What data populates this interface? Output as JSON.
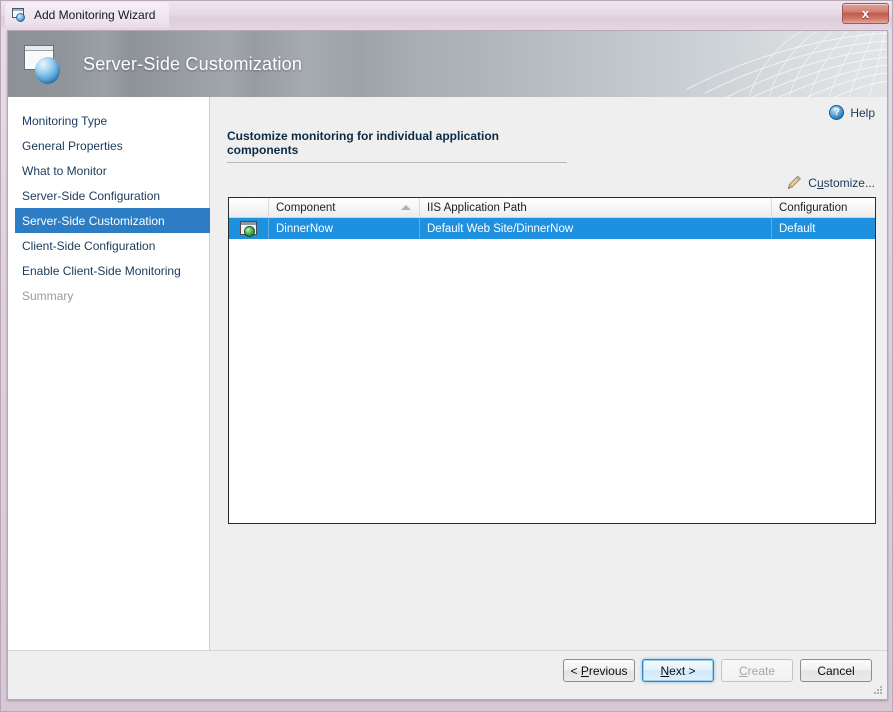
{
  "window": {
    "title": "Add Monitoring Wizard",
    "close_label": "x",
    "titlebar_icon": "wizard-window-icon"
  },
  "banner": {
    "title": "Server-Side Customization",
    "icon": "window-sphere-icon"
  },
  "sidebar": {
    "items": [
      {
        "label": "Monitoring Type",
        "state": "normal"
      },
      {
        "label": "General Properties",
        "state": "normal"
      },
      {
        "label": "What to Monitor",
        "state": "normal"
      },
      {
        "label": "Server-Side Configuration",
        "state": "normal"
      },
      {
        "label": "Server-Side Customization",
        "state": "selected"
      },
      {
        "label": "Client-Side Configuration",
        "state": "normal"
      },
      {
        "label": "Enable Client-Side Monitoring",
        "state": "normal"
      },
      {
        "label": "Summary",
        "state": "disabled"
      }
    ],
    "selected_index": 4
  },
  "main": {
    "help_label": "Help",
    "help_icon": "help-circle-icon",
    "heading": "Customize monitoring for individual application components",
    "customize_label": "Customize...",
    "customize_icon": "pencil-icon",
    "table": {
      "columns": [
        "",
        "Component",
        "IIS Application Path",
        "Configuration"
      ],
      "sort_column": "Component",
      "sort_direction": "ascending",
      "rows": [
        {
          "icon": "web-application-icon",
          "component": "DinnerNow",
          "iis_application_path": "Default Web Site/DinnerNow",
          "configuration": "Default",
          "selected": true
        }
      ]
    }
  },
  "footer": {
    "previous": {
      "label": "< Previous",
      "accel": "P",
      "state": "enabled"
    },
    "next": {
      "label": "Next >",
      "accel": "N",
      "state": "default"
    },
    "create": {
      "label": "Create",
      "accel": "C",
      "state": "disabled"
    },
    "cancel": {
      "label": "Cancel",
      "accel": "",
      "state": "enabled"
    }
  },
  "colors": {
    "selection_blue": "#1e90e0",
    "sidebar_selection": "#2d7dc4",
    "link_text": "#1b3a5c",
    "window_chrome": "#ddcddc"
  }
}
